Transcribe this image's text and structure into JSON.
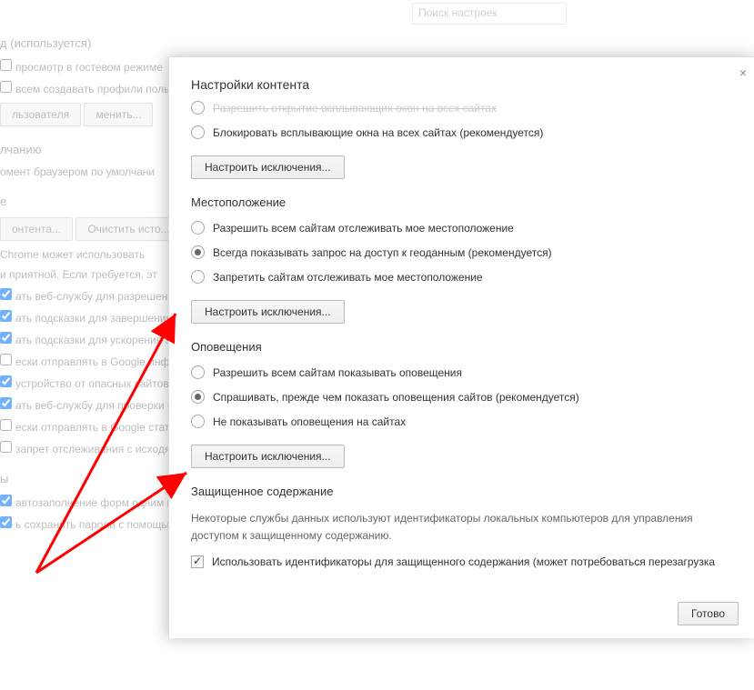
{
  "background": {
    "search_placeholder": "Поиск настроек",
    "heading_top": "д (используется)",
    "guest_mode": "просмотр в гостевом режиме",
    "allow_create_profiles": "всем создавать профили польз",
    "btn_user": "льзователя",
    "btn_change": "менить...",
    "heading_default": "лчанию",
    "row_default_browser": "омент браузером по умолчани",
    "heading_e": "е",
    "btn_content": "онтента...",
    "btn_clear_history": "Очистить исто...",
    "row_chrome_services1": "Chrome может использовать",
    "row_chrome_services2": "и приятной. Если требуется, эт",
    "items": [
      "ать веб-службу для разрешения",
      "ать подсказки для завершения в",
      "ать подсказки для ускорения за",
      "ески отправлять в Google инфор",
      "устройство от опасных сайтов",
      "ать веб-службу для проверки пр",
      "ески отправлять в Google стати",
      "запрет отслеживания с исходя"
    ],
    "heading_y": "ы",
    "autofill": "автозаполнение форм одним кли",
    "save_passwords": "ь сохранять пароли с помощью"
  },
  "overlay": {
    "title": "Настройки контента",
    "popups": {
      "opt_allow": "Разрешить открытие всплывающих окон на всех сайтах",
      "opt_block": "Блокировать всплывающие окна на всех сайтах (рекомендуется)",
      "exceptions_btn": "Настроить исключения..."
    },
    "location": {
      "title": "Местоположение",
      "opt_allow": "Разрешить всем сайтам отслеживать мое местоположение",
      "opt_ask": "Всегда показывать запрос на доступ к геоданным (рекомендуется)",
      "opt_block": "Запретить сайтам отслеживать мое местоположение",
      "exceptions_btn": "Настроить исключения..."
    },
    "notifications": {
      "title": "Оповещения",
      "opt_allow": "Разрешить всем сайтам показывать оповещения",
      "opt_ask": "Спрашивать, прежде чем показать оповещения сайтов (рекомендуется)",
      "opt_block": "Не показывать оповещения на сайтах",
      "exceptions_btn": "Настроить исключения..."
    },
    "protected": {
      "title": "Защищенное содержание",
      "desc": "Некоторые службы данных используют идентификаторы локальных компьютеров для управления доступом к защищенному содержанию.",
      "checkbox_label": "Использовать идентификаторы для защищенного содержания (может потребоваться перезагрузка"
    },
    "done_btn": "Готово",
    "close_label": "×"
  }
}
